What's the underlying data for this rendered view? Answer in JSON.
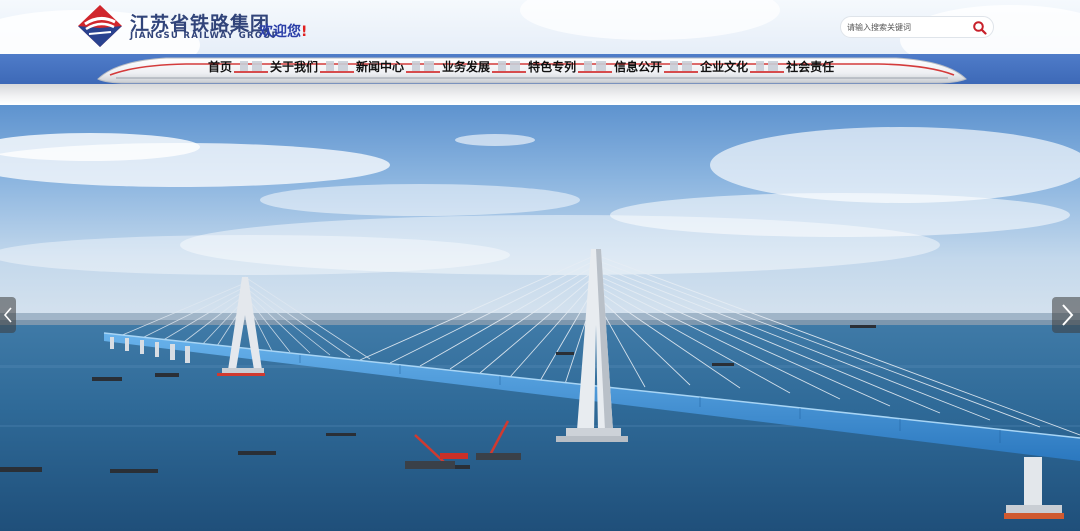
{
  "brand": {
    "name_cn": "江苏省铁路集团",
    "name_en": "JIANGSU RAILWAY GROUP",
    "welcome": "欢迎您",
    "welcome_mark": "!"
  },
  "search": {
    "placeholder": "请输入搜索关键词",
    "icon": "search-icon"
  },
  "nav": {
    "items": [
      {
        "label": "首页"
      },
      {
        "label": "关于我们"
      },
      {
        "label": "新闻中心"
      },
      {
        "label": "业务发展"
      },
      {
        "label": "特色专列"
      },
      {
        "label": "信息公开"
      },
      {
        "label": "企业文化"
      },
      {
        "label": "社会责任"
      }
    ]
  },
  "banner": {
    "image": "cable-stayed-bridge-photo",
    "prev_icon": "chevron-left-icon",
    "next_icon": "chevron-right-icon"
  },
  "colors": {
    "nav_blue": "#3d69b7",
    "brand_text": "#31447a",
    "logo_red": "#d0262c",
    "bridge_blue": "#3e8fd6"
  }
}
